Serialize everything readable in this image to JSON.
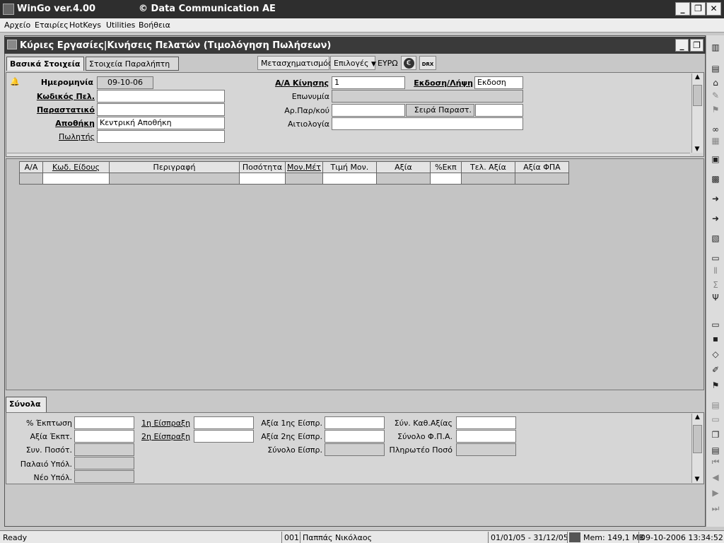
{
  "app": {
    "title": "WinGo ver.4.00",
    "company": "© Data Communication AE",
    "window_buttons": {
      "minimize": "_",
      "restore": "❐",
      "close": "✕"
    }
  },
  "menu": [
    "Αρχείο",
    "Εταιρίες",
    "HotKeys",
    "Utilities",
    "Βοήθεια"
  ],
  "child": {
    "title": "Κύριες Εργασίες|Κινήσεις Πελατών (Τιμολόγηση Πωλήσεων)"
  },
  "tabs": [
    "Βασικά Στοιχεία",
    "Στοιχεία Παραλήπτη"
  ],
  "toolbar": {
    "transform": "Μετασχηματισμός",
    "options": "Επιλογές",
    "currency": "ΕΥΡΩ",
    "euro_symbol": "€",
    "drx": "DRX"
  },
  "header_form": {
    "date_label": "Ημερομηνία",
    "date_value": "09-10-06",
    "customer_code_label": "Κωδικός Πελ.",
    "customer_code_value": "",
    "document_label": "Παραστατικό",
    "document_value": "",
    "warehouse_label": "Αποθήκη",
    "warehouse_value": "Κεντρική Αποθήκη",
    "seller_label": "Πωλητής",
    "seller_value": "",
    "movement_no_label": "Α/Α Κίνησης",
    "movement_no_value": "1",
    "issue_label": "Εκδοση/Λήψη",
    "issue_value": "Εκδοση",
    "name_label": "Επωνυμία",
    "name_value": "",
    "doc_number_label": "Αρ.Παρ/κού",
    "doc_number_value": "",
    "series_label": "Σειρά Παραστ.",
    "series_value": "",
    "reason_label": "Αιτιολογία",
    "reason_value": ""
  },
  "lines_table": {
    "columns": [
      "Α/Α",
      "Κωδ. Είδους",
      "Περιγραφή",
      "Ποσότητα",
      "Μον.Μέτ",
      "Τιμή Μον.",
      "Αξία",
      "%Εκπ",
      "Τελ. Αξία",
      "Αξία ΦΠΑ"
    ]
  },
  "totals_tab": "Σύνολα",
  "totals": {
    "discount_pct": "% Έκπτωση",
    "discount_value": "Αξία Έκπτ.",
    "total_qty": "Συν. Ποσότ.",
    "old_balance": "Παλαιό Υπόλ.",
    "new_balance": "Νέο Υπόλ.",
    "collection1": "1η Είσπραξη",
    "collection2": "2η Είσπραξη",
    "value_collection1": "Αξία 1ης Είσπρ.",
    "value_collection2": "Αξία 2ης Είσπρ.",
    "total_collection": "Σύνολο Είσπρ.",
    "total_net": "Σύν. Καθ.Αξίας",
    "total_vat": "Σύνολο Φ.Π.Α.",
    "payable": "Πληρωτέο Ποσό"
  },
  "status": {
    "ready": "Ready",
    "code": "001",
    "user": "Παππάς Νικόλαος",
    "period": "01/01/05 - 31/12/05",
    "mem": "Mem: 149,1 MB",
    "datetime": "09-10-2006 13:34:52"
  },
  "right_toolbar_icons": [
    "columns-icon",
    "report-icon",
    "bank-icon",
    "pencil-icon",
    "flag-icon",
    "binoculars-icon",
    "calculator-icon",
    "building-icon",
    "printer-icon",
    "import-icon",
    "export-icon",
    "grid-icon",
    "folder-open-icon",
    "split-icon",
    "sigma-icon",
    "insert-icon",
    "folder-open-icon",
    "save-icon",
    "eraser-icon",
    "brush-icon",
    "flag-icon",
    "stack-icon",
    "print-icon",
    "copy-icon",
    "document-icon",
    "first-icon",
    "prev-icon",
    "next-icon",
    "last-icon"
  ]
}
